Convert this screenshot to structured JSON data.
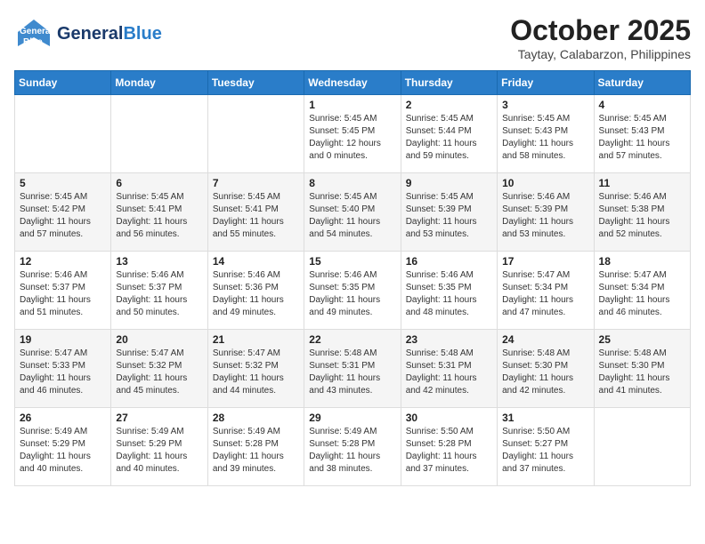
{
  "logo": {
    "line1": "General",
    "line2": "Blue",
    "url_label": "GeneralBlue"
  },
  "title": "October 2025",
  "subtitle": "Taytay, Calabarzon, Philippines",
  "days_of_week": [
    "Sunday",
    "Monday",
    "Tuesday",
    "Wednesday",
    "Thursday",
    "Friday",
    "Saturday"
  ],
  "weeks": [
    [
      {
        "day": "",
        "details": ""
      },
      {
        "day": "",
        "details": ""
      },
      {
        "day": "",
        "details": ""
      },
      {
        "day": "1",
        "details": "Sunrise: 5:45 AM\nSunset: 5:45 PM\nDaylight: 12 hours\nand 0 minutes."
      },
      {
        "day": "2",
        "details": "Sunrise: 5:45 AM\nSunset: 5:44 PM\nDaylight: 11 hours\nand 59 minutes."
      },
      {
        "day": "3",
        "details": "Sunrise: 5:45 AM\nSunset: 5:43 PM\nDaylight: 11 hours\nand 58 minutes."
      },
      {
        "day": "4",
        "details": "Sunrise: 5:45 AM\nSunset: 5:43 PM\nDaylight: 11 hours\nand 57 minutes."
      }
    ],
    [
      {
        "day": "5",
        "details": "Sunrise: 5:45 AM\nSunset: 5:42 PM\nDaylight: 11 hours\nand 57 minutes."
      },
      {
        "day": "6",
        "details": "Sunrise: 5:45 AM\nSunset: 5:41 PM\nDaylight: 11 hours\nand 56 minutes."
      },
      {
        "day": "7",
        "details": "Sunrise: 5:45 AM\nSunset: 5:41 PM\nDaylight: 11 hours\nand 55 minutes."
      },
      {
        "day": "8",
        "details": "Sunrise: 5:45 AM\nSunset: 5:40 PM\nDaylight: 11 hours\nand 54 minutes."
      },
      {
        "day": "9",
        "details": "Sunrise: 5:45 AM\nSunset: 5:39 PM\nDaylight: 11 hours\nand 53 minutes."
      },
      {
        "day": "10",
        "details": "Sunrise: 5:46 AM\nSunset: 5:39 PM\nDaylight: 11 hours\nand 53 minutes."
      },
      {
        "day": "11",
        "details": "Sunrise: 5:46 AM\nSunset: 5:38 PM\nDaylight: 11 hours\nand 52 minutes."
      }
    ],
    [
      {
        "day": "12",
        "details": "Sunrise: 5:46 AM\nSunset: 5:37 PM\nDaylight: 11 hours\nand 51 minutes."
      },
      {
        "day": "13",
        "details": "Sunrise: 5:46 AM\nSunset: 5:37 PM\nDaylight: 11 hours\nand 50 minutes."
      },
      {
        "day": "14",
        "details": "Sunrise: 5:46 AM\nSunset: 5:36 PM\nDaylight: 11 hours\nand 49 minutes."
      },
      {
        "day": "15",
        "details": "Sunrise: 5:46 AM\nSunset: 5:35 PM\nDaylight: 11 hours\nand 49 minutes."
      },
      {
        "day": "16",
        "details": "Sunrise: 5:46 AM\nSunset: 5:35 PM\nDaylight: 11 hours\nand 48 minutes."
      },
      {
        "day": "17",
        "details": "Sunrise: 5:47 AM\nSunset: 5:34 PM\nDaylight: 11 hours\nand 47 minutes."
      },
      {
        "day": "18",
        "details": "Sunrise: 5:47 AM\nSunset: 5:34 PM\nDaylight: 11 hours\nand 46 minutes."
      }
    ],
    [
      {
        "day": "19",
        "details": "Sunrise: 5:47 AM\nSunset: 5:33 PM\nDaylight: 11 hours\nand 46 minutes."
      },
      {
        "day": "20",
        "details": "Sunrise: 5:47 AM\nSunset: 5:32 PM\nDaylight: 11 hours\nand 45 minutes."
      },
      {
        "day": "21",
        "details": "Sunrise: 5:47 AM\nSunset: 5:32 PM\nDaylight: 11 hours\nand 44 minutes."
      },
      {
        "day": "22",
        "details": "Sunrise: 5:48 AM\nSunset: 5:31 PM\nDaylight: 11 hours\nand 43 minutes."
      },
      {
        "day": "23",
        "details": "Sunrise: 5:48 AM\nSunset: 5:31 PM\nDaylight: 11 hours\nand 42 minutes."
      },
      {
        "day": "24",
        "details": "Sunrise: 5:48 AM\nSunset: 5:30 PM\nDaylight: 11 hours\nand 42 minutes."
      },
      {
        "day": "25",
        "details": "Sunrise: 5:48 AM\nSunset: 5:30 PM\nDaylight: 11 hours\nand 41 minutes."
      }
    ],
    [
      {
        "day": "26",
        "details": "Sunrise: 5:49 AM\nSunset: 5:29 PM\nDaylight: 11 hours\nand 40 minutes."
      },
      {
        "day": "27",
        "details": "Sunrise: 5:49 AM\nSunset: 5:29 PM\nDaylight: 11 hours\nand 40 minutes."
      },
      {
        "day": "28",
        "details": "Sunrise: 5:49 AM\nSunset: 5:28 PM\nDaylight: 11 hours\nand 39 minutes."
      },
      {
        "day": "29",
        "details": "Sunrise: 5:49 AM\nSunset: 5:28 PM\nDaylight: 11 hours\nand 38 minutes."
      },
      {
        "day": "30",
        "details": "Sunrise: 5:50 AM\nSunset: 5:28 PM\nDaylight: 11 hours\nand 37 minutes."
      },
      {
        "day": "31",
        "details": "Sunrise: 5:50 AM\nSunset: 5:27 PM\nDaylight: 11 hours\nand 37 minutes."
      },
      {
        "day": "",
        "details": ""
      }
    ]
  ]
}
